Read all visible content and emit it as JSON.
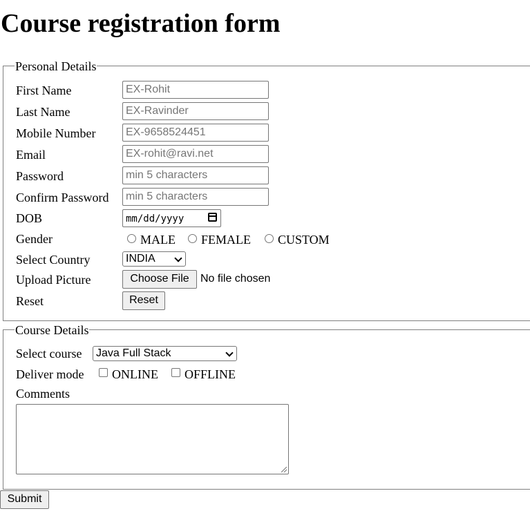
{
  "page": {
    "title": "Course registration form"
  },
  "personal": {
    "legend": "Personal Details",
    "first_name": {
      "label": "First Name",
      "placeholder": "EX-Rohit"
    },
    "last_name": {
      "label": "Last Name",
      "placeholder": "EX-Ravinder"
    },
    "mobile": {
      "label": "Mobile Number",
      "placeholder": "EX-9658524451"
    },
    "email": {
      "label": "Email",
      "placeholder": "EX-rohit@ravi.net"
    },
    "password": {
      "label": "Password",
      "placeholder": "min 5 characters"
    },
    "confirm_password": {
      "label": "Confirm Password",
      "placeholder": "min 5 characters"
    },
    "dob": {
      "label": "DOB",
      "value": "mm/dd/yyyy"
    },
    "gender": {
      "label": "Gender",
      "options": [
        "MALE",
        "FEMALE",
        "CUSTOM"
      ]
    },
    "country": {
      "label": "Select Country",
      "selected": "INDIA"
    },
    "upload": {
      "label": "Upload Picture",
      "button": "Choose File",
      "status": "No file chosen"
    },
    "reset": {
      "label": "Reset",
      "button": "Reset"
    }
  },
  "course": {
    "legend": "Course Details",
    "select": {
      "label": "Select course",
      "selected": "Java Full Stack"
    },
    "deliver": {
      "label": "Deliver mode",
      "options": [
        "ONLINE",
        "OFFLINE"
      ]
    },
    "comments": {
      "label": "Comments",
      "value": ""
    }
  },
  "submit": {
    "label": "Submit"
  },
  "colors": {
    "border": "#767676",
    "fieldset_border": "#808080",
    "button_bg": "#efefef",
    "placeholder": "#767676"
  }
}
